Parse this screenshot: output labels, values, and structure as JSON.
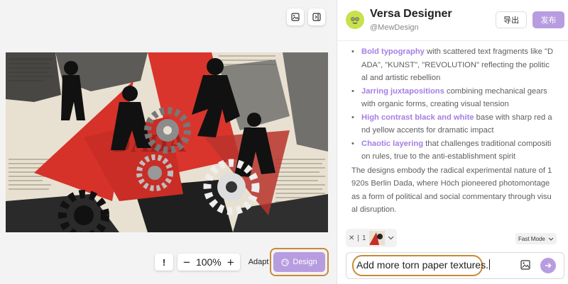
{
  "canvas": {
    "zoom_level": "100%",
    "adapt_label": "Adapt",
    "bang_label": "!",
    "minus_label": "−",
    "plus_label": "+",
    "design_label": "Design",
    "artwork_text": "DADA"
  },
  "header": {
    "title": "Versa Designer",
    "handle": "@MewDesign",
    "export_label": "导出",
    "publish_label": "发布"
  },
  "message": {
    "bullets": [
      {
        "bold": "Bold typography",
        "rest": " with scattered text fragments like \"DADA\", \"KUNST\", \"REVOLUTION\" reflecting the political and artistic rebellion"
      },
      {
        "bold": "Jarring juxtapositions",
        "rest": " combining mechanical gears with organic forms, creating visual tension"
      },
      {
        "bold": "High contrast black and white",
        "rest": " base with sharp red and yellow accents for dramatic impact"
      },
      {
        "bold": "Chaotic layering",
        "rest": " that challenges traditional composition rules, true to the anti-establishment spirit"
      }
    ],
    "paragraph": "The designs embody the radical experimental nature of 1920s Berlin Dada, where Höch pioneered photomontage as a form of political and social commentary through visual disruption."
  },
  "attachments": {
    "count": "1",
    "mode": "Fast Mode"
  },
  "composer": {
    "value": "Add more torn paper textures."
  },
  "colors": {
    "accent": "#b79de0",
    "highlight": "#a57ee6",
    "callout": "#c98a3a"
  }
}
